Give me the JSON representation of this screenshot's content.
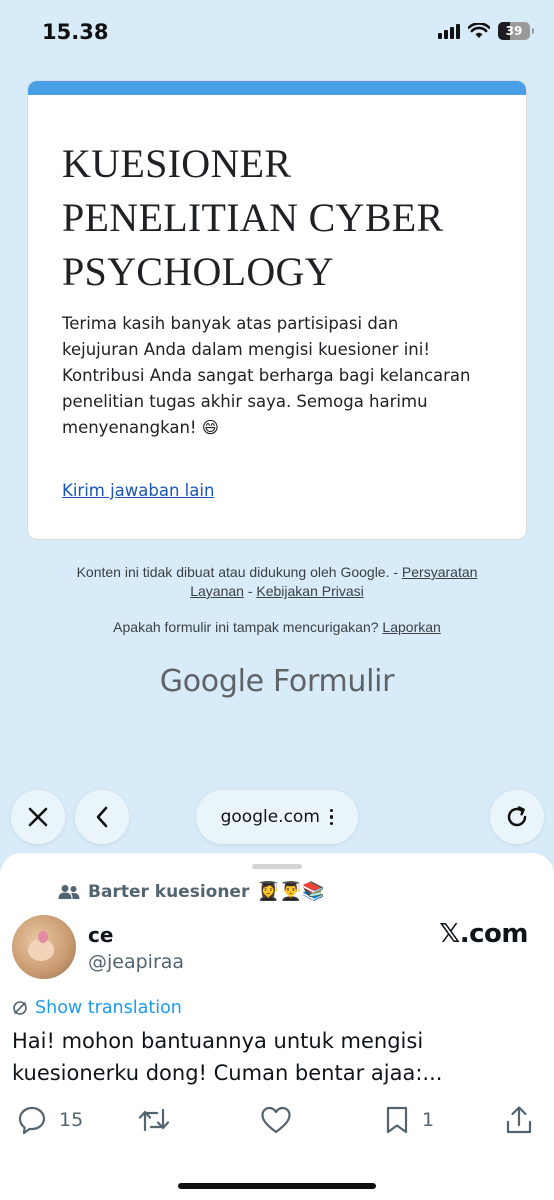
{
  "status_bar": {
    "time": "15.38",
    "battery_level": "39",
    "battery_fraction": 0.39,
    "icons": [
      "signal-icon",
      "wifi-icon",
      "battery-icon"
    ]
  },
  "form": {
    "accent_color": "#4b9fe7",
    "title_lines": [
      "KUESIONER",
      "PENELITIAN CYBER",
      "PSYCHOLOGY"
    ],
    "description_lines": [
      "Terima kasih banyak atas partisipasi dan",
      "kejujuran Anda dalam mengisi kuesioner ini!",
      "Kontribusi Anda sangat berharga bagi kelancaran",
      "penelitian tugas akhir saya. Semoga harimu",
      "menyenangkan! 😄"
    ],
    "resubmit_link": "Kirim jawaban lain"
  },
  "footer": {
    "disclaimer_text": "Konten ini tidak dibuat atau didukung oleh Google. - ",
    "terms_link_part1": "Persyaratan",
    "terms_link_part2": "Layanan",
    "separator": " - ",
    "privacy_link": "Kebijakan Privasi",
    "report_question": "Apakah formulir ini tampak mencurigakan? ",
    "report_link": "Laporkan",
    "brand_google": "Google",
    "brand_product": "Formulir"
  },
  "browser": {
    "url": "google.com",
    "icons": [
      "close-icon",
      "back-icon",
      "more-icon",
      "reload-icon"
    ]
  },
  "tweet": {
    "community": "Barter kuesioner",
    "community_emojis": "👩‍🎓👨‍🎓📚",
    "display_name": "ce",
    "handle": "@jeapiraa",
    "site_label": "𝕏.com",
    "translate_label": "Show translation",
    "text_lines": [
      "Hai! mohon bantuannya untuk mengisi",
      "kuesionerku dong! Cuman bentar ajaa:..."
    ],
    "reply_count": "15",
    "retweet_count": "",
    "like_count": "",
    "bookmark_count": "1"
  }
}
